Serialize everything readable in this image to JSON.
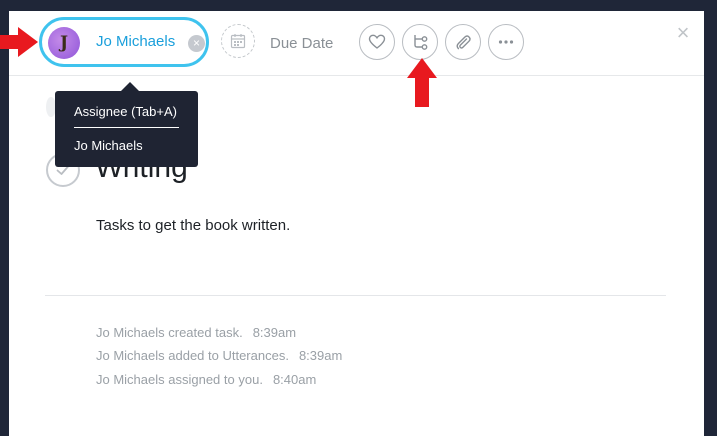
{
  "toolbar": {
    "assignee": {
      "initials": "J",
      "name": "Jo Michaels",
      "clear_symbol": "×"
    },
    "due_date": {
      "icon": "calendar-icon",
      "label": "Due Date"
    },
    "actions": [
      {
        "name": "heart-icon"
      },
      {
        "name": "subtask-icon"
      },
      {
        "name": "paperclip-icon"
      },
      {
        "name": "more-icon"
      }
    ],
    "close_symbol": "×"
  },
  "tooltip": {
    "title": "Assignee (Tab+A)",
    "name": "Jo Michaels"
  },
  "task": {
    "title": "Writing",
    "description": "Tasks to get the book written."
  },
  "activity": [
    {
      "text": "Jo Michaels created task.",
      "time": "8:39am"
    },
    {
      "text": "Jo Michaels added to Utterances.",
      "time": "8:39am"
    },
    {
      "text": "Jo Michaels assigned to you.",
      "time": "8:40am"
    }
  ],
  "colors": {
    "accent": "#3fc3ee",
    "link": "#1a9fdb",
    "annotation_arrow": "#e8191f"
  }
}
